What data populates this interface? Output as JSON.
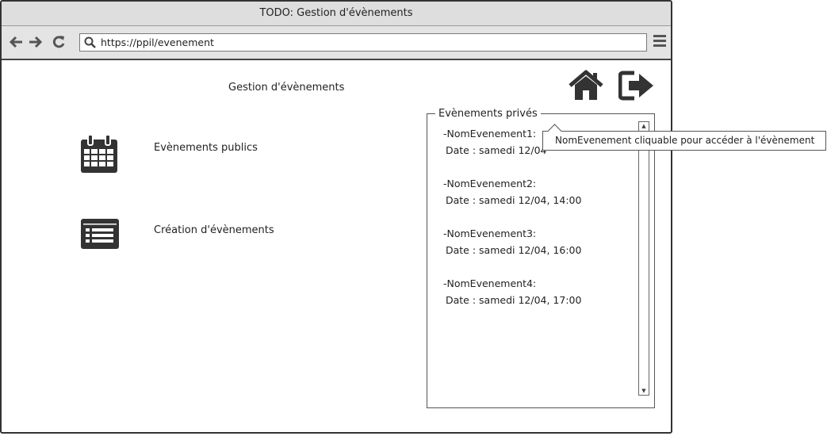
{
  "window": {
    "title": "TODO: Gestion d'évènements"
  },
  "browser": {
    "url": "https://ppil/evenement"
  },
  "page": {
    "title": "Gestion d'évènements",
    "links": {
      "public_events": "Evènements publics",
      "create_event": "Création d'évènements"
    }
  },
  "private_events": {
    "legend": "Evènements privés",
    "items": [
      {
        "name": "-NomEvenement1:",
        "date": "Date : samedi 12/04"
      },
      {
        "name": "-NomEvenement2:",
        "date": "Date : samedi 12/04, 14:00"
      },
      {
        "name": "-NomEvenement3:",
        "date": "Date : samedi 12/04, 16:00"
      },
      {
        "name": "-NomEvenement4:",
        "date": "Date : samedi 12/04, 17:00"
      }
    ]
  },
  "tooltip": {
    "text": "NomEvenement cliquable pour accéder à l'évènement"
  },
  "icons": {
    "back": "arrow-left-icon",
    "forward": "arrow-right-icon",
    "reload": "reload-icon",
    "search": "search-icon",
    "menu": "hamburger-menu-icon",
    "home": "home-icon",
    "logout": "sign-out-icon",
    "calendar": "calendar-icon",
    "list": "list-icon"
  }
}
